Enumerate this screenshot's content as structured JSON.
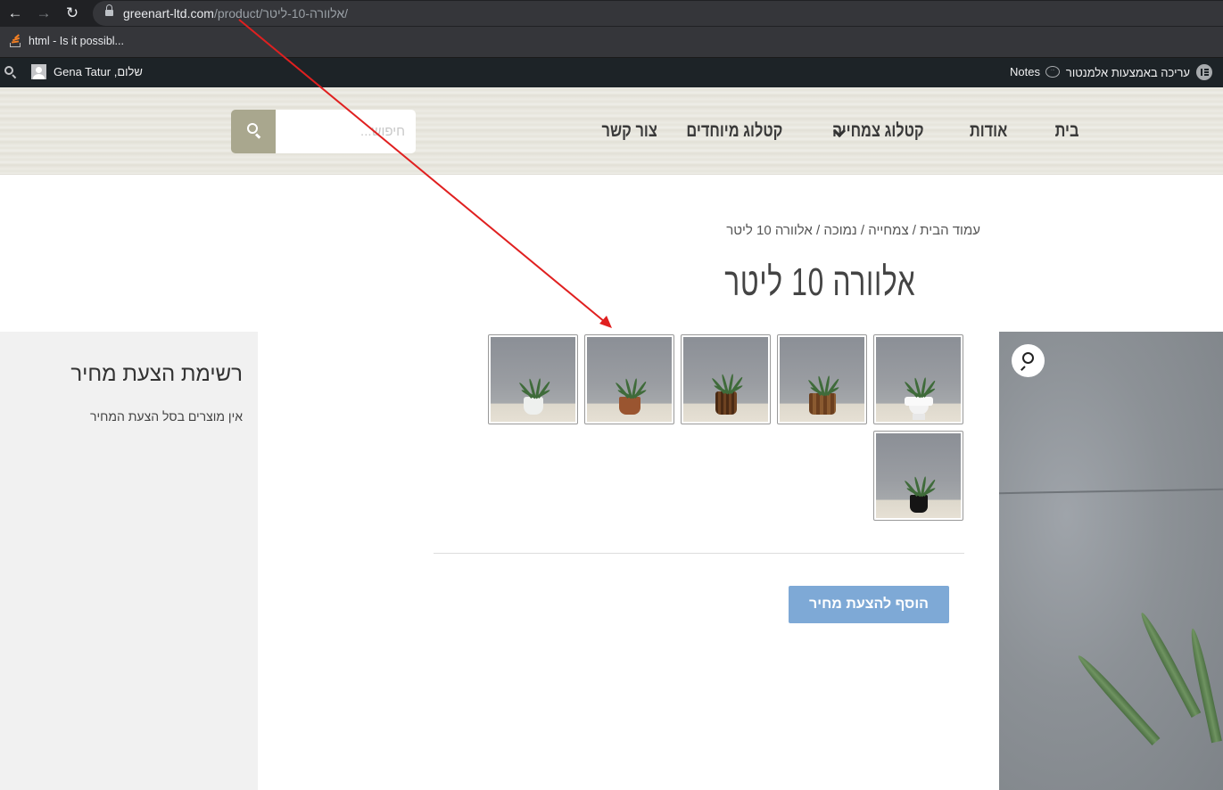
{
  "browser": {
    "url_host": "greenart-ltd.com",
    "url_path": "/product/אלוורה-10-ליטר/",
    "bookmark_label": "html - Is it possibl..."
  },
  "adminbar": {
    "greeting": "שלום, Gena Tatur",
    "notes_label": "Notes",
    "notes_bubble": "···",
    "elementor_label": "עריכה באמצעות אלמנטור"
  },
  "header": {
    "search_placeholder": "חיפוש...",
    "menu": [
      "בית",
      "אודות",
      "קטלוג צמחייה",
      "קטלוג מיוחדים",
      "צור קשר"
    ]
  },
  "breadcrumb": {
    "items": [
      "עמוד הבית",
      "צמחייה",
      "נמוכה",
      "אלוורה 10 ליטר"
    ],
    "separator": " / "
  },
  "product": {
    "title": "אלוורה 10 ליטר",
    "add_button": "הוסף להצעת מחיר",
    "thumbnails": [
      {
        "pot": "white-urn"
      },
      {
        "pot": "brown-wood"
      },
      {
        "pot": "dark-wood"
      },
      {
        "pot": "terracotta"
      },
      {
        "pot": "white-round"
      },
      {
        "pot": "black"
      }
    ]
  },
  "sidebar": {
    "title": "רשימת הצעת מחיר",
    "empty_text": "אין מוצרים בסל הצעת המחיר"
  },
  "colors": {
    "search_button": "#a9a78e",
    "add_button": "#7ea9d6",
    "annotation_arrow": "#e02020"
  }
}
